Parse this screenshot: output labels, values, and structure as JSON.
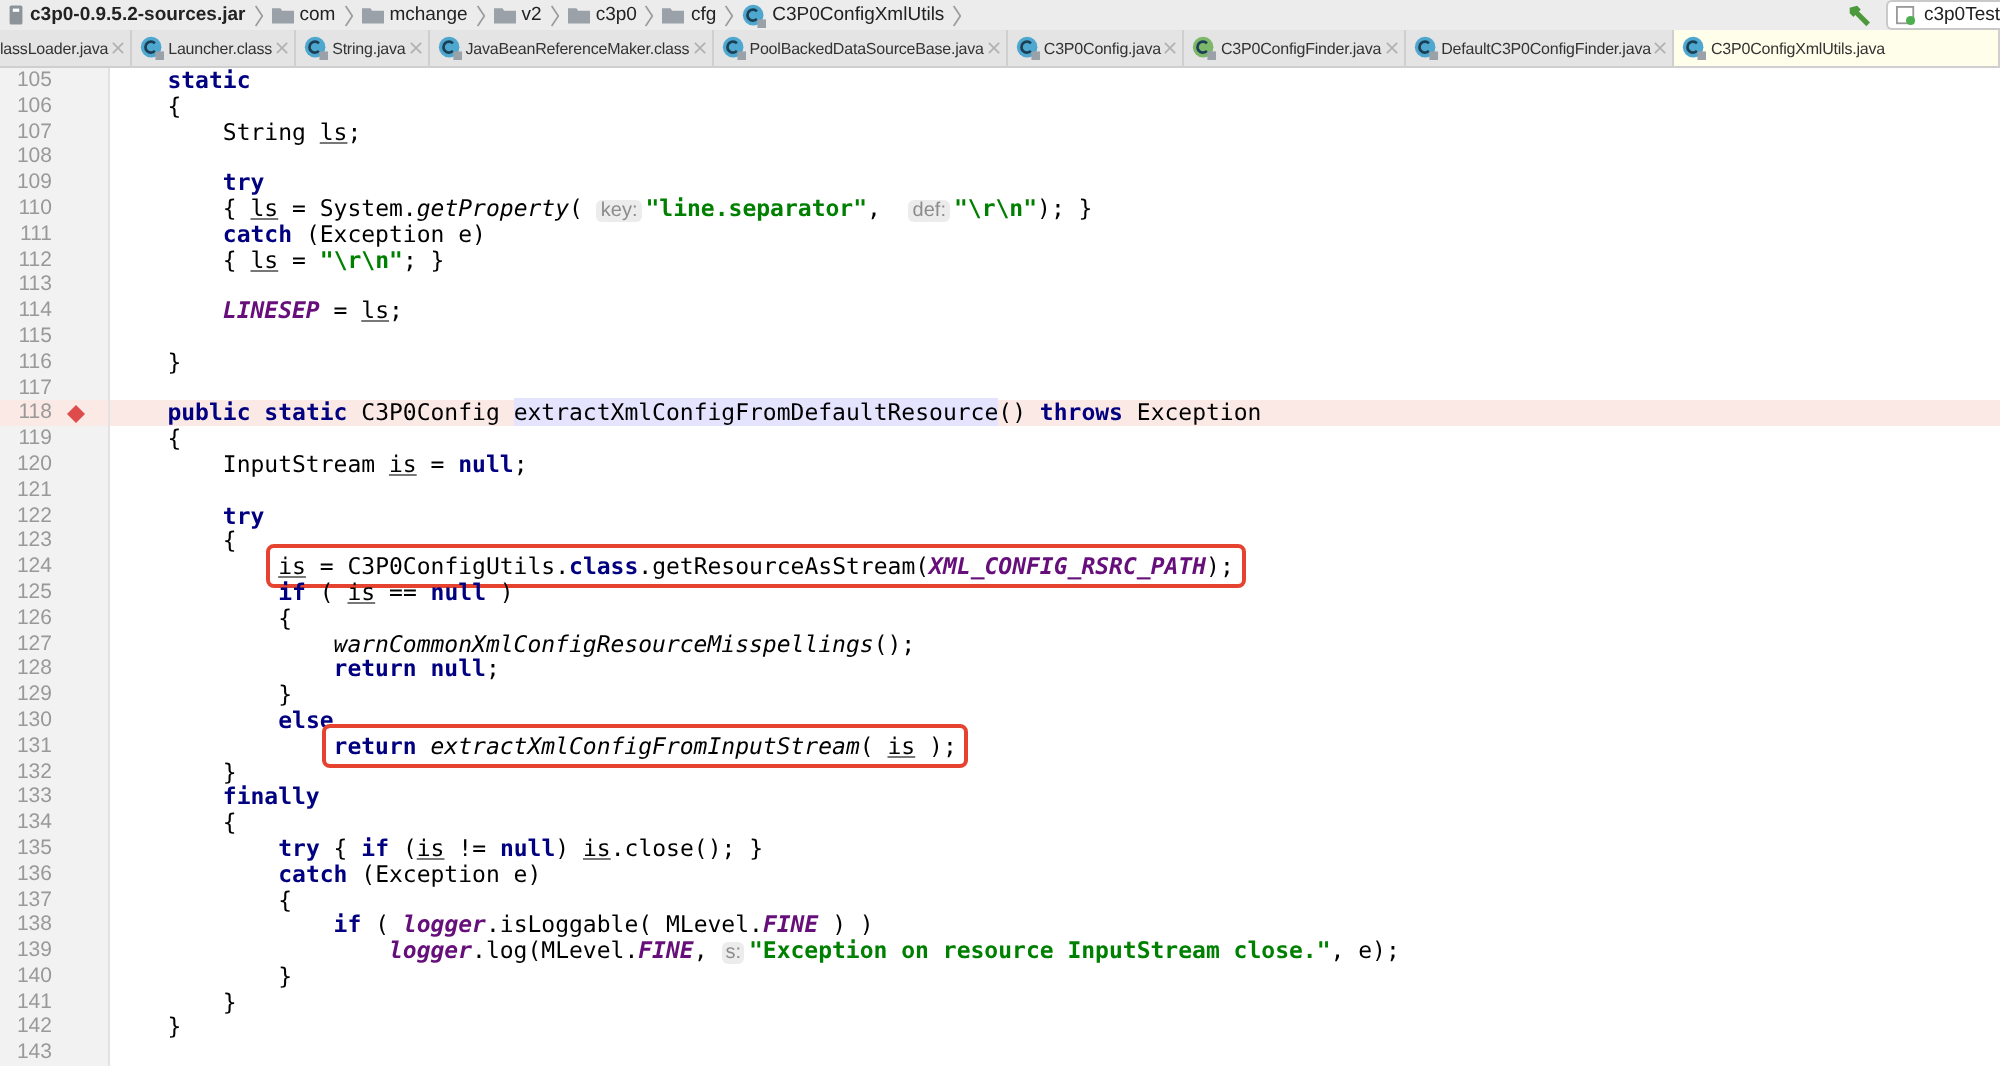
{
  "breadcrumb": [
    {
      "label": "c3p0-0.9.5.2-sources.jar",
      "kind": "jar"
    },
    {
      "label": "com",
      "kind": "folder"
    },
    {
      "label": "mchange",
      "kind": "folder"
    },
    {
      "label": "v2",
      "kind": "folder"
    },
    {
      "label": "c3p0",
      "kind": "folder"
    },
    {
      "label": "cfg",
      "kind": "folder"
    },
    {
      "label": "C3P0ConfigXmlUtils",
      "kind": "class"
    }
  ],
  "run_config": {
    "label": "c3p0Test"
  },
  "tabs": [
    {
      "label": "lassLoader.java",
      "kind": "none",
      "selected": false
    },
    {
      "label": "Launcher.class",
      "kind": "class",
      "selected": false
    },
    {
      "label": "String.java",
      "kind": "class",
      "selected": false
    },
    {
      "label": "JavaBeanReferenceMaker.class",
      "kind": "class",
      "selected": false
    },
    {
      "label": "PoolBackedDataSourceBase.java",
      "kind": "class",
      "selected": false
    },
    {
      "label": "C3P0Config.java",
      "kind": "class",
      "selected": false
    },
    {
      "label": "C3P0ConfigFinder.java",
      "kind": "interface",
      "selected": false
    },
    {
      "label": "DefaultC3P0ConfigFinder.java",
      "kind": "class",
      "selected": false
    },
    {
      "label": "C3P0ConfigXmlUtils.java",
      "kind": "class",
      "selected": true
    }
  ],
  "lines": [
    {
      "number": "105",
      "breakpoint": false,
      "boxed": false,
      "tokens": [
        {
          "t": "    static",
          "kind": "keyword"
        }
      ]
    },
    {
      "number": "106",
      "breakpoint": false,
      "boxed": false,
      "tokens": [
        {
          "t": "    {",
          "kind": "plain"
        }
      ]
    },
    {
      "number": "107",
      "breakpoint": false,
      "boxed": false,
      "tokens": [
        {
          "t": "        String ",
          "kind": "plain"
        },
        {
          "t": "ls",
          "kind": "variable"
        },
        {
          "t": ";",
          "kind": "plain"
        }
      ]
    },
    {
      "number": "108",
      "breakpoint": false,
      "boxed": false
    },
    {
      "number": "109",
      "breakpoint": false,
      "boxed": false,
      "tokens": [
        {
          "t": "        try",
          "kind": "keyword"
        }
      ]
    },
    {
      "number": "110",
      "breakpoint": false,
      "boxed": false,
      "tokens": [
        {
          "t": "        { ",
          "kind": "plain"
        },
        {
          "t": "ls",
          "kind": "variable"
        },
        {
          "t": " = System.",
          "kind": "plain"
        },
        {
          "t": "getProperty",
          "kind": "italic"
        },
        {
          "t": "( ",
          "kind": "plain"
        },
        {
          "t": "key:",
          "kind": "hint"
        },
        {
          "t": "\"line.separator\"",
          "kind": "string"
        },
        {
          "t": ",  ",
          "kind": "plain"
        },
        {
          "t": "def:",
          "kind": "hint"
        },
        {
          "t": "\"\\r\\n\"",
          "kind": "string"
        },
        {
          "t": "); }",
          "kind": "plain"
        }
      ]
    },
    {
      "number": "111",
      "breakpoint": false,
      "boxed": false,
      "tokens": [
        {
          "t": "        catch",
          "kind": "keyword"
        },
        {
          "t": " (Exception e)",
          "kind": "plain"
        }
      ]
    },
    {
      "number": "112",
      "breakpoint": false,
      "boxed": false,
      "tokens": [
        {
          "t": "        { ",
          "kind": "plain"
        },
        {
          "t": "ls",
          "kind": "variable"
        },
        {
          "t": " = ",
          "kind": "plain"
        },
        {
          "t": "\"\\r\\n\"",
          "kind": "string"
        },
        {
          "t": "; }",
          "kind": "plain"
        }
      ]
    },
    {
      "number": "113",
      "breakpoint": false,
      "boxed": false
    },
    {
      "number": "114",
      "breakpoint": false,
      "boxed": false,
      "tokens": [
        {
          "t": "        LINESEP",
          "kind": "field"
        },
        {
          "t": " = ",
          "kind": "plain"
        },
        {
          "t": "ls",
          "kind": "variable"
        },
        {
          "t": ";",
          "kind": "plain"
        }
      ]
    },
    {
      "number": "115",
      "breakpoint": false,
      "boxed": false
    },
    {
      "number": "116",
      "breakpoint": false,
      "boxed": false,
      "tokens": [
        {
          "t": "    }",
          "kind": "plain"
        }
      ]
    },
    {
      "number": "117",
      "breakpoint": false,
      "boxed": false
    },
    {
      "number": "118",
      "breakpoint": true,
      "boxed": false,
      "tokens": [
        {
          "t": "    public static",
          "kind": "keyword"
        },
        {
          "t": " C3P0Config ",
          "kind": "plain"
        },
        {
          "t": "extractXmlConfigFromDefaultResource",
          "kind": "usage"
        },
        {
          "t": "() ",
          "kind": "plain"
        },
        {
          "t": "throws",
          "kind": "keyword"
        },
        {
          "t": " Exception",
          "kind": "plain"
        }
      ]
    },
    {
      "number": "119",
      "breakpoint": false,
      "boxed": false,
      "tokens": [
        {
          "t": "    {",
          "kind": "plain"
        }
      ]
    },
    {
      "number": "120",
      "breakpoint": false,
      "boxed": false,
      "tokens": [
        {
          "t": "        InputStream ",
          "kind": "plain"
        },
        {
          "t": "is",
          "kind": "variable"
        },
        {
          "t": " = ",
          "kind": "plain"
        },
        {
          "t": "null",
          "kind": "keyword"
        },
        {
          "t": ";",
          "kind": "plain"
        }
      ]
    },
    {
      "number": "121",
      "breakpoint": false,
      "boxed": false
    },
    {
      "number": "122",
      "breakpoint": false,
      "boxed": false,
      "tokens": [
        {
          "t": "        try",
          "kind": "keyword"
        }
      ]
    },
    {
      "number": "123",
      "breakpoint": false,
      "boxed": false,
      "tokens": [
        {
          "t": "        {",
          "kind": "plain"
        }
      ]
    },
    {
      "number": "124",
      "breakpoint": false,
      "boxed": true,
      "tokens": [
        {
          "t": "            is",
          "kind": "variable"
        },
        {
          "t": " = C3P0ConfigUtils.",
          "kind": "plain"
        },
        {
          "t": "class",
          "kind": "keyword"
        },
        {
          "t": ".getResourceAsStream(",
          "kind": "plain"
        },
        {
          "t": "XML_CONFIG_RSRC_PATH",
          "kind": "field"
        },
        {
          "t": ");",
          "kind": "plain"
        }
      ]
    },
    {
      "number": "125",
      "breakpoint": false,
      "boxed": false,
      "tokens": [
        {
          "t": "            if",
          "kind": "keyword"
        },
        {
          "t": " ( ",
          "kind": "plain"
        },
        {
          "t": "is",
          "kind": "variable"
        },
        {
          "t": " == ",
          "kind": "plain"
        },
        {
          "t": "null",
          "kind": "keyword"
        },
        {
          "t": " )",
          "kind": "plain"
        }
      ]
    },
    {
      "number": "126",
      "breakpoint": false,
      "boxed": false,
      "tokens": [
        {
          "t": "            {",
          "kind": "plain"
        }
      ]
    },
    {
      "number": "127",
      "breakpoint": false,
      "boxed": false,
      "tokens": [
        {
          "t": "                warnCommonXmlConfigResourceMisspellings",
          "kind": "italic"
        },
        {
          "t": "();",
          "kind": "plain"
        }
      ]
    },
    {
      "number": "128",
      "breakpoint": false,
      "boxed": false,
      "tokens": [
        {
          "t": "                return null",
          "kind": "keyword"
        },
        {
          "t": ";",
          "kind": "plain"
        }
      ]
    },
    {
      "number": "129",
      "breakpoint": false,
      "boxed": false,
      "tokens": [
        {
          "t": "            }",
          "kind": "plain"
        }
      ]
    },
    {
      "number": "130",
      "breakpoint": false,
      "boxed": false,
      "tokens": [
        {
          "t": "            else",
          "kind": "keyword"
        }
      ]
    },
    {
      "number": "131",
      "breakpoint": false,
      "boxed": true,
      "tokens": [
        {
          "t": "                return ",
          "kind": "keyword"
        },
        {
          "t": "extractXmlConfigFromInputStream",
          "kind": "italic"
        },
        {
          "t": "( ",
          "kind": "plain"
        },
        {
          "t": "is",
          "kind": "variable"
        },
        {
          "t": " );",
          "kind": "plain"
        }
      ]
    },
    {
      "number": "132",
      "breakpoint": false,
      "boxed": false,
      "tokens": [
        {
          "t": "        }",
          "kind": "plain"
        }
      ]
    },
    {
      "number": "133",
      "breakpoint": false,
      "boxed": false,
      "tokens": [
        {
          "t": "        finally",
          "kind": "keyword"
        }
      ]
    },
    {
      "number": "134",
      "breakpoint": false,
      "boxed": false,
      "tokens": [
        {
          "t": "        {",
          "kind": "plain"
        }
      ]
    },
    {
      "number": "135",
      "breakpoint": false,
      "boxed": false,
      "tokens": [
        {
          "t": "            try",
          "kind": "keyword"
        },
        {
          "t": " { ",
          "kind": "plain"
        },
        {
          "t": "if",
          "kind": "keyword"
        },
        {
          "t": " (",
          "kind": "plain"
        },
        {
          "t": "is",
          "kind": "variable"
        },
        {
          "t": " != ",
          "kind": "plain"
        },
        {
          "t": "null",
          "kind": "keyword"
        },
        {
          "t": ") ",
          "kind": "plain"
        },
        {
          "t": "is",
          "kind": "variable"
        },
        {
          "t": ".close(); }",
          "kind": "plain"
        }
      ]
    },
    {
      "number": "136",
      "breakpoint": false,
      "boxed": false,
      "tokens": [
        {
          "t": "            catch",
          "kind": "keyword"
        },
        {
          "t": " (Exception e)",
          "kind": "plain"
        }
      ]
    },
    {
      "number": "137",
      "breakpoint": false,
      "boxed": false,
      "tokens": [
        {
          "t": "            {",
          "kind": "plain"
        }
      ]
    },
    {
      "number": "138",
      "breakpoint": false,
      "boxed": false,
      "tokens": [
        {
          "t": "                if",
          "kind": "keyword"
        },
        {
          "t": " ( ",
          "kind": "plain"
        },
        {
          "t": "logger",
          "kind": "field"
        },
        {
          "t": ".isLoggable( MLevel.",
          "kind": "plain"
        },
        {
          "t": "FINE",
          "kind": "field"
        },
        {
          "t": " ) )",
          "kind": "plain"
        }
      ]
    },
    {
      "number": "139",
      "breakpoint": false,
      "boxed": false,
      "tokens": [
        {
          "t": "                    logger",
          "kind": "field"
        },
        {
          "t": ".log(MLevel.",
          "kind": "plain"
        },
        {
          "t": "FINE",
          "kind": "field"
        },
        {
          "t": ", ",
          "kind": "plain"
        },
        {
          "t": "s:",
          "kind": "hint"
        },
        {
          "t": "\"Exception on resource InputStream close.\"",
          "kind": "string"
        },
        {
          "t": ", e);",
          "kind": "plain"
        }
      ]
    },
    {
      "number": "140",
      "breakpoint": false,
      "boxed": false,
      "tokens": [
        {
          "t": "            }",
          "kind": "plain"
        }
      ]
    },
    {
      "number": "141",
      "breakpoint": false,
      "boxed": false,
      "tokens": [
        {
          "t": "        }",
          "kind": "plain"
        }
      ]
    },
    {
      "number": "142",
      "breakpoint": false,
      "boxed": false,
      "tokens": [
        {
          "t": "    }",
          "kind": "plain"
        }
      ]
    },
    {
      "number": "143",
      "breakpoint": false,
      "boxed": false
    }
  ]
}
